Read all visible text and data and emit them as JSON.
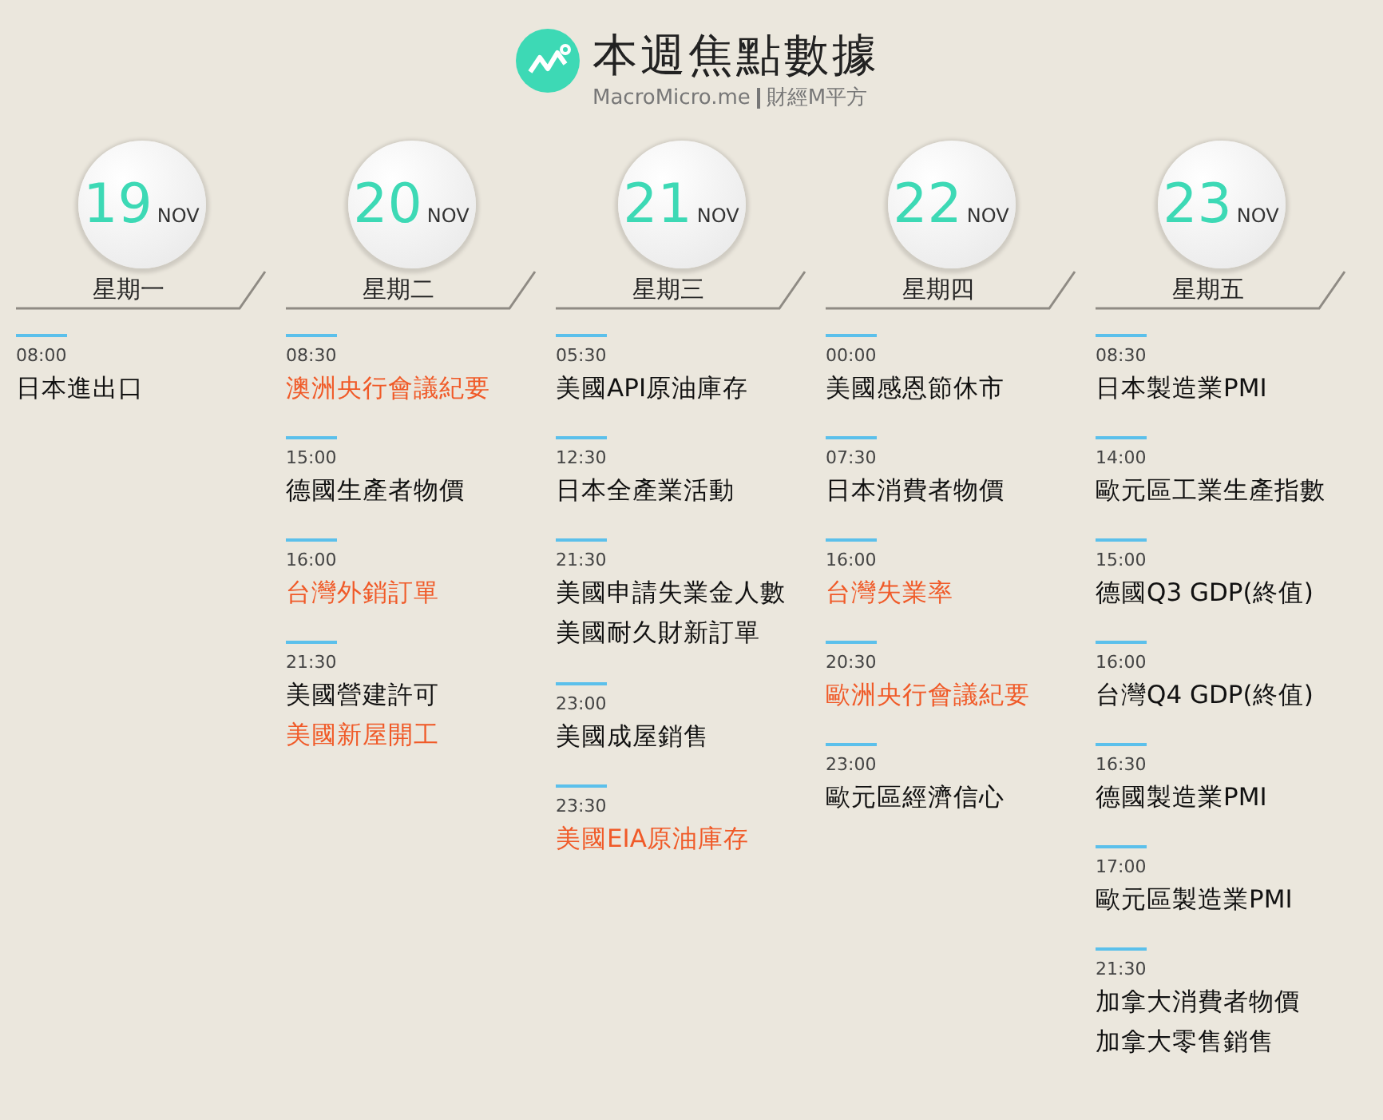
{
  "header": {
    "title": "本週焦點數據",
    "site": "MacroMicro.me",
    "brand": "財經M平方"
  },
  "days": [
    {
      "day": "19",
      "month": "NOV",
      "weekday": "星期一",
      "slots": [
        {
          "time": "08:00",
          "events": [
            {
              "name": "日本進出口",
              "highlight": false
            }
          ]
        }
      ]
    },
    {
      "day": "20",
      "month": "NOV",
      "weekday": "星期二",
      "slots": [
        {
          "time": "08:30",
          "events": [
            {
              "name": "澳洲央行會議紀要",
              "highlight": true
            }
          ]
        },
        {
          "time": "15:00",
          "events": [
            {
              "name": "德國生產者物價",
              "highlight": false
            }
          ]
        },
        {
          "time": "16:00",
          "events": [
            {
              "name": "台灣外銷訂單",
              "highlight": true
            }
          ]
        },
        {
          "time": "21:30",
          "events": [
            {
              "name": "美國營建許可",
              "highlight": false
            },
            {
              "name": "美國新屋開工",
              "highlight": true
            }
          ]
        }
      ]
    },
    {
      "day": "21",
      "month": "NOV",
      "weekday": "星期三",
      "slots": [
        {
          "time": "05:30",
          "events": [
            {
              "name": "美國API原油庫存",
              "highlight": false
            }
          ]
        },
        {
          "time": "12:30",
          "events": [
            {
              "name": "日本全產業活動",
              "highlight": false
            }
          ]
        },
        {
          "time": "21:30",
          "events": [
            {
              "name": "美國申請失業金人數",
              "highlight": false
            },
            {
              "name": "美國耐久財新訂單",
              "highlight": false
            }
          ]
        },
        {
          "time": "23:00",
          "events": [
            {
              "name": "美國成屋銷售",
              "highlight": false
            }
          ]
        },
        {
          "time": "23:30",
          "events": [
            {
              "name": "美國EIA原油庫存",
              "highlight": true
            }
          ]
        }
      ]
    },
    {
      "day": "22",
      "month": "NOV",
      "weekday": "星期四",
      "slots": [
        {
          "time": "00:00",
          "events": [
            {
              "name": "美國感恩節休市",
              "highlight": false
            }
          ]
        },
        {
          "time": "07:30",
          "events": [
            {
              "name": "日本消費者物價",
              "highlight": false
            }
          ]
        },
        {
          "time": "16:00",
          "events": [
            {
              "name": "台灣失業率",
              "highlight": true
            }
          ]
        },
        {
          "time": "20:30",
          "events": [
            {
              "name": "歐洲央行會議紀要",
              "highlight": true
            }
          ]
        },
        {
          "time": "23:00",
          "events": [
            {
              "name": "歐元區經濟信心",
              "highlight": false
            }
          ]
        }
      ]
    },
    {
      "day": "23",
      "month": "NOV",
      "weekday": "星期五",
      "slots": [
        {
          "time": "08:30",
          "events": [
            {
              "name": "日本製造業PMI",
              "highlight": false
            }
          ]
        },
        {
          "time": "14:00",
          "events": [
            {
              "name": "歐元區工業生產指數",
              "highlight": false
            }
          ]
        },
        {
          "time": "15:00",
          "events": [
            {
              "name": "德國Q3 GDP(終值)",
              "highlight": false
            }
          ]
        },
        {
          "time": "16:00",
          "events": [
            {
              "name": "台灣Q4 GDP(終值)",
              "highlight": false
            }
          ]
        },
        {
          "time": "16:30",
          "events": [
            {
              "name": "德國製造業PMI",
              "highlight": false
            }
          ]
        },
        {
          "time": "17:00",
          "events": [
            {
              "name": "歐元區製造業PMI",
              "highlight": false
            }
          ]
        },
        {
          "time": "21:30",
          "events": [
            {
              "name": "加拿大消費者物價",
              "highlight": false
            },
            {
              "name": "加拿大零售銷售",
              "highlight": false
            }
          ]
        }
      ]
    }
  ]
}
